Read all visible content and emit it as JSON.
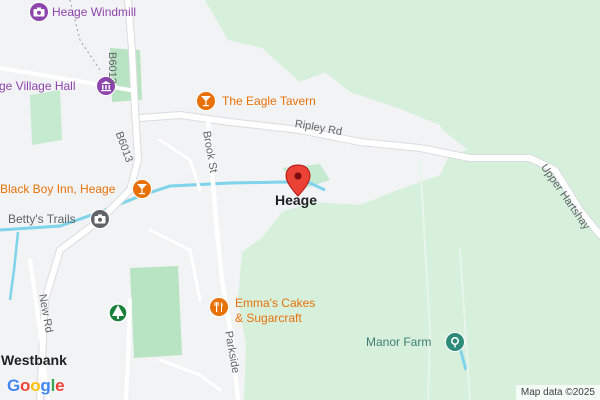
{
  "map": {
    "place_label": "Heage",
    "roads": {
      "b6013_north": "B6013",
      "b6013_south": "B6013",
      "ripley_rd": "Ripley Rd",
      "brook_st": "Brook St",
      "upper_hartshay": "Upper Hartshay",
      "new_rd": "New Rd",
      "parkside": "Parkside"
    },
    "pois": {
      "windmill": "Heage Windmill",
      "village_hall": "ge Village Hall",
      "eagle_tavern": "The Eagle Tavern",
      "black_boy_inn": "Black Boy Inn, Heage",
      "bettys_trails": "Betty's Trails",
      "emmas_cakes_line1": "Emma's Cakes",
      "emmas_cakes_line2": "& Sugarcraft",
      "westbank": "Westbank",
      "manor_farm": "Manor Farm"
    },
    "icons": {
      "windmill": "camera-icon",
      "village_hall": "museum-icon",
      "eagle_tavern": "cocktail-icon",
      "black_boy_inn": "cocktail-icon",
      "bettys_trails": "camera-icon",
      "emmas_cakes": "fork-knife-icon",
      "tree": "tree-icon",
      "manor_farm": "park-icon"
    },
    "colors": {
      "land": "#d6f0dc",
      "urban": "#f1f3f4",
      "park": "#b9e4c3",
      "water": "#7fd3ea",
      "road": "#ffffff",
      "marker": "#ea4335",
      "poi_purple": "#8e44ad",
      "poi_orange": "#e8710a",
      "poi_grey": "#5f6368",
      "poi_teal": "#2e8b7a"
    },
    "attribution": "Map data ©2025",
    "logo": "Google"
  }
}
